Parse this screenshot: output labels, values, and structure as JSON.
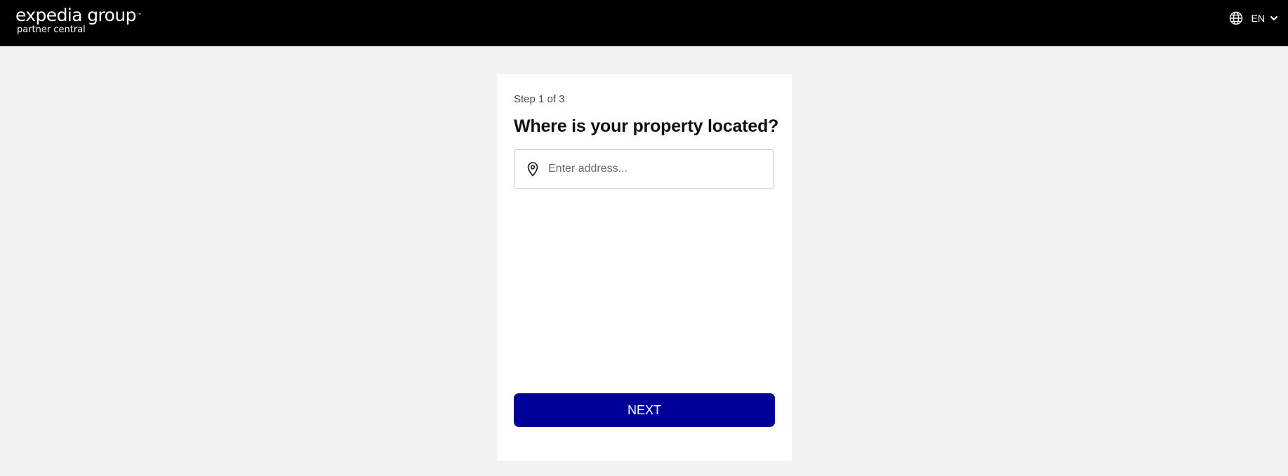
{
  "header": {
    "logo_main": "expedia group",
    "logo_tm": "™",
    "logo_sub": "partner central",
    "language_icon": "globe-icon",
    "language_label": "EN",
    "language_chevron_icon": "chevron-down-icon"
  },
  "form": {
    "step_label": "Step 1 of 3",
    "heading": "Where is your property located?",
    "address_icon": "location-pin-icon",
    "address_placeholder": "Enter address...",
    "address_value": "",
    "next_label": "NEXT"
  },
  "colors": {
    "header_bg": "#000000",
    "page_bg": "#f2f2f2",
    "card_bg": "#ffffff",
    "primary_button": "#000099"
  }
}
